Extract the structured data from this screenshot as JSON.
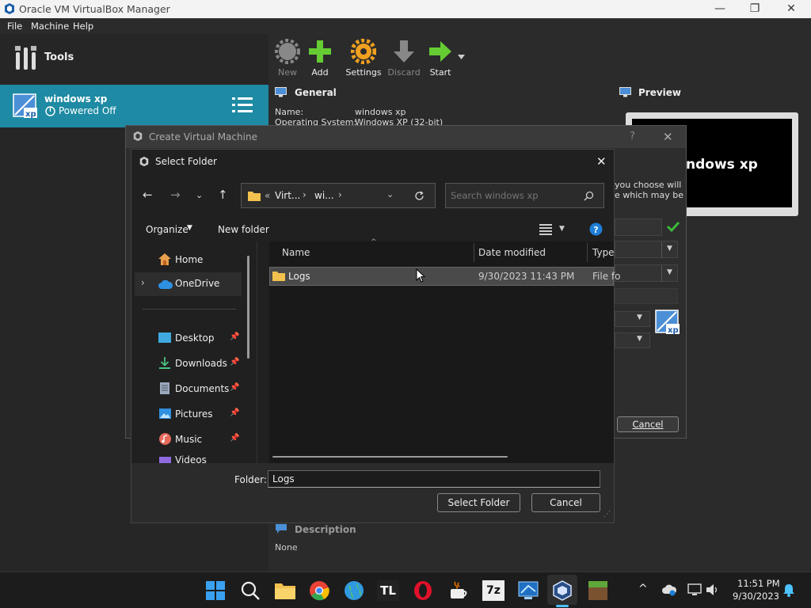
{
  "window": {
    "title": "Oracle VM VirtualBox Manager"
  },
  "menu": [
    "File",
    "Machine",
    "Help"
  ],
  "sidebar": {
    "tools_label": "Tools",
    "vm": {
      "name": "windows xp",
      "state": "Powered Off"
    }
  },
  "toolbar": {
    "new": "New",
    "add": "Add",
    "settings": "Settings",
    "discard": "Discard",
    "start": "Start"
  },
  "details": {
    "general": {
      "title": "General",
      "name_label": "Name:",
      "name_value": "windows xp",
      "os_label": "Operating System:",
      "os_value": "Windows XP (32-bit)"
    },
    "preview": {
      "title": "Preview",
      "screen_text": "ndows xp"
    },
    "description": {
      "title": "Description",
      "value": "None"
    }
  },
  "create_vm": {
    "title": "Create Virtual Machine",
    "help": "?",
    "partial_text_1": "you choose will",
    "partial_text_2": "e which may be",
    "cancel": "Cancel"
  },
  "select_folder": {
    "title": "Select Folder",
    "address": {
      "prefix": "«",
      "crumbs": [
        "Virt...",
        "wi..."
      ]
    },
    "search_placeholder": "Search windows xp",
    "organize": "Organize",
    "new_folder": "New folder",
    "nav": {
      "home": "Home",
      "onedrive": "OneDrive",
      "quick": [
        "Desktop",
        "Downloads",
        "Documents",
        "Pictures",
        "Music",
        "Videos"
      ]
    },
    "columns": {
      "name": "Name",
      "date": "Date modified",
      "type": "Type"
    },
    "files": [
      {
        "name": "Logs",
        "date": "9/30/2023 11:43 PM",
        "type": "File fo"
      }
    ],
    "folder_label": "Folder:",
    "folder_value": "Logs",
    "select_button": "Select Folder",
    "cancel_button": "Cancel"
  },
  "taskbar": {
    "tl_label": "TL",
    "sevenzip_label": "7z",
    "time": "11:51 PM",
    "date": "9/30/2023"
  }
}
